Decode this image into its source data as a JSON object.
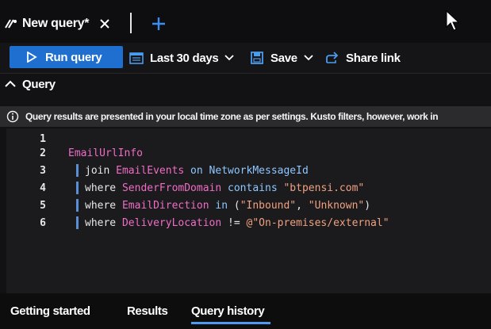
{
  "tab": {
    "label": "New query*",
    "icon": "query-edit-icon",
    "close_icon": "close-icon",
    "add_icon": "plus-icon"
  },
  "toolbar": {
    "run_label": "Run query",
    "time_range_label": "Last 30 days",
    "save_label": "Save",
    "share_label": "Share link"
  },
  "section": {
    "title": "Query"
  },
  "info": {
    "message": "Query results are presented in your local time zone as per settings. Kusto filters, however, work in"
  },
  "editor": {
    "lines": [
      {
        "num": "1"
      },
      {
        "num": "2",
        "tokens": [
          {
            "t": "EmailUrlInfo",
            "k": "tbl"
          }
        ]
      },
      {
        "num": "3",
        "pipe": true,
        "tokens": [
          {
            "t": "join ",
            "k": "op"
          },
          {
            "t": "EmailEvents",
            "k": "tbl"
          },
          {
            "t": " on ",
            "k": "kw"
          },
          {
            "t": "NetworkMessageId",
            "k": "kw"
          }
        ]
      },
      {
        "num": "4",
        "pipe": true,
        "tokens": [
          {
            "t": "where ",
            "k": "op"
          },
          {
            "t": "SenderFromDomain",
            "k": "col"
          },
          {
            "t": " contains ",
            "k": "kw"
          },
          {
            "t": "\"btpensi.com\"",
            "k": "str"
          }
        ]
      },
      {
        "num": "5",
        "pipe": true,
        "tokens": [
          {
            "t": "where ",
            "k": "op"
          },
          {
            "t": "EmailDirection",
            "k": "col"
          },
          {
            "t": " in ",
            "k": "kw"
          },
          {
            "t": "(",
            "k": "op"
          },
          {
            "t": "\"Inbound\"",
            "k": "str"
          },
          {
            "t": ", ",
            "k": "op"
          },
          {
            "t": "\"Unknown\"",
            "k": "str"
          },
          {
            "t": ")",
            "k": "op"
          }
        ]
      },
      {
        "num": "6",
        "pipe": true,
        "tokens": [
          {
            "t": "where ",
            "k": "op"
          },
          {
            "t": "DeliveryLocation",
            "k": "col"
          },
          {
            "t": " != ",
            "k": "op"
          },
          {
            "t": "@\"On-premises/external\"",
            "k": "str"
          }
        ]
      }
    ]
  },
  "bottom_tabs": {
    "getting_started": "Getting started",
    "results": "Results",
    "query_history": "Query history",
    "active": "Query history"
  },
  "colors": {
    "accent": "#1f6fd1",
    "tab_underline": "#4a9cf0",
    "keyword": "#8ec6ff",
    "identifier": "#f06cc6",
    "string": "#f0a080"
  }
}
